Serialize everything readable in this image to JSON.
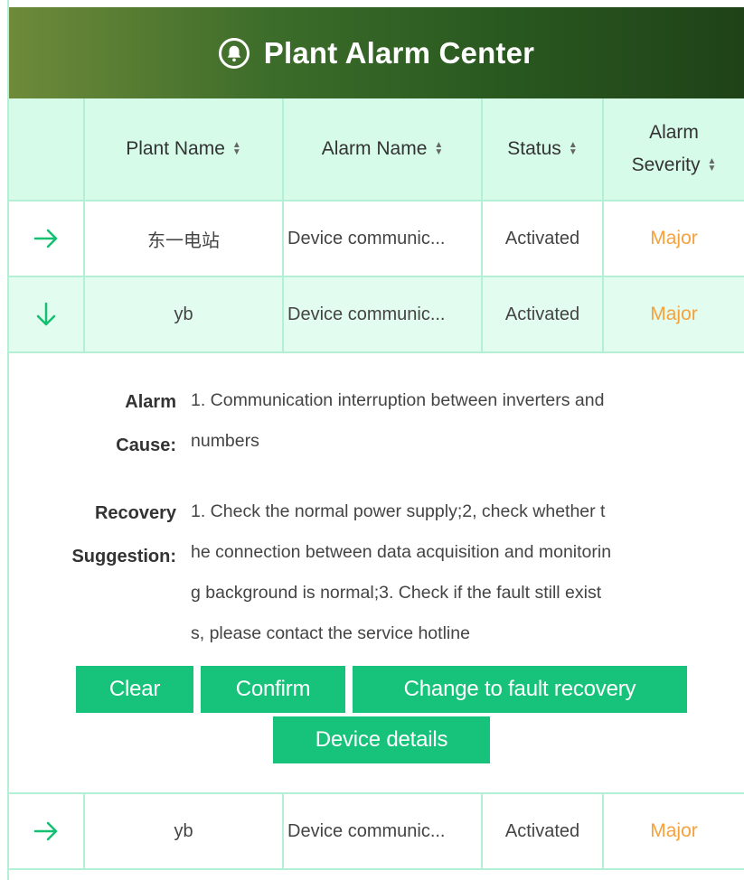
{
  "header": {
    "title": "Plant Alarm Center",
    "icon": "bell-icon"
  },
  "columns": {
    "plant_name": "Plant Name",
    "alarm_name": "Alarm Name",
    "status": "Status",
    "severity_line1": "Alarm",
    "severity_line2": "Severity"
  },
  "rows": [
    {
      "plant": "东一电站",
      "alarm": "Device communic...",
      "status": "Activated",
      "severity": "Major",
      "arrow": "→"
    },
    {
      "plant": "yb",
      "alarm": "Device communic...",
      "status": "Activated",
      "severity": "Major",
      "arrow": "↓"
    },
    {
      "plant": "yb",
      "alarm": "Device communic...",
      "status": "Activated",
      "severity": "Major",
      "arrow": "→"
    }
  ],
  "detail": {
    "cause_label_1": "Alarm",
    "cause_label_2": "Cause:",
    "cause_line1": "1. Communication interruption between inverters and",
    "cause_line2": "numbers",
    "suggestion_label_1": "Recovery",
    "suggestion_label_2": "Suggestion:",
    "suggestion_line1": "1. Check the normal power supply;2, check whether t",
    "suggestion_line2": "he connection between data acquisition and monitorin",
    "suggestion_line3": "g background is normal;3. Check if the fault still exist",
    "suggestion_line4": "s, please contact the service hotline"
  },
  "buttons": {
    "clear": "Clear",
    "confirm": "Confirm",
    "fault_recovery": "Change to fault recovery",
    "device_details": "Device details"
  },
  "colors": {
    "accent": "#17c37a",
    "severity_major": "#f5a13c",
    "header_bg": "#d6fbe8",
    "border": "#b3f0d6"
  }
}
